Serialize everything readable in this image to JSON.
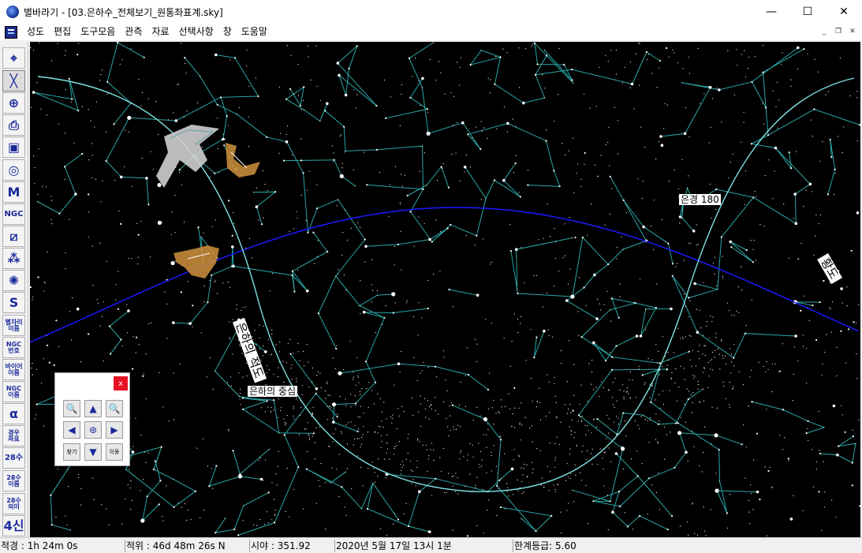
{
  "window": {
    "title": "별바라기 - [03.은하수_전체보기_원통좌표계.sky]",
    "buttons": [
      "—",
      "☐",
      "✕"
    ]
  },
  "menu": {
    "items": [
      "성도",
      "편집",
      "도구모음",
      "관측",
      "자료",
      "선택사항",
      "창",
      "도움말"
    ],
    "mdi_buttons": [
      "_",
      "❐",
      "✕"
    ]
  },
  "toolbar": {
    "tools": [
      {
        "name": "cursor-tool",
        "label": "⌖",
        "icon": "crosshair-icon"
      },
      {
        "name": "constellation-lines-tool",
        "label": "╳",
        "icon": "constellation-icon",
        "active": true
      },
      {
        "name": "grid-tool",
        "label": "⊕",
        "icon": "globe-grid-icon"
      },
      {
        "name": "printer-tool",
        "label": "⎙",
        "icon": "printer-icon"
      },
      {
        "name": "sky-view-tool",
        "label": "▣",
        "icon": "sky-view-icon"
      },
      {
        "name": "galaxy-tool",
        "label": "◎",
        "icon": "galaxy-icon"
      },
      {
        "name": "messier-tool",
        "label": "M",
        "icon": "messier-icon"
      },
      {
        "name": "ngc-tool",
        "label": "NGC",
        "icon": "ngc-icon"
      },
      {
        "name": "milky-way-tool",
        "label": "⧄",
        "icon": "milky-way-icon"
      },
      {
        "name": "nebula-tool",
        "label": "⁂",
        "icon": "nebula-icon"
      },
      {
        "name": "deep-sky-tool",
        "label": "✺",
        "icon": "deep-sky-icon"
      },
      {
        "name": "ecliptic-tool",
        "label": "S",
        "icon": "ecliptic-icon"
      },
      {
        "name": "star-names-tool",
        "label": "별자리\n이름",
        "icon": "star-names-icon"
      },
      {
        "name": "ngc-numbers-tool",
        "label": "NGC\n번호",
        "icon": "ngc-numbers-icon"
      },
      {
        "name": "bayer-names-tool",
        "label": "바이어\n이름",
        "icon": "bayer-names-icon"
      },
      {
        "name": "ngc-names-tool",
        "label": "NGC\n이름",
        "icon": "ngc-names-icon"
      },
      {
        "name": "alpha-tool",
        "label": "α",
        "icon": "alpha-icon"
      },
      {
        "name": "coordinates-tool",
        "label": "경우\n좌표",
        "icon": "coordinates-icon"
      },
      {
        "name": "28-mansions-tool",
        "label": "28수",
        "icon": "mansions-icon"
      },
      {
        "name": "28-names-tool",
        "label": "28수\n이름",
        "icon": "mansions-names-icon"
      },
      {
        "name": "28-meanings-tool",
        "label": "28수\n의미",
        "icon": "mansions-meanings-icon"
      },
      {
        "name": "four-beasts-tool",
        "label": "4신",
        "icon": "four-beasts-icon"
      }
    ]
  },
  "sky": {
    "labels": {
      "galactic_longitude": "은경 180",
      "ecliptic": "황도",
      "galactic_equator": "은하의 적도",
      "galactic_center": "은하의 중심"
    },
    "colors": {
      "background": "#000000",
      "constellation_lines": "#2aa6a6",
      "ecliptic": "#1a1aff",
      "galactic_equator": "#7fe3e3",
      "stars": "#ffffff"
    }
  },
  "navigator": {
    "close": "x",
    "buttons": [
      {
        "name": "zoom-out-button",
        "label": "🔍",
        "icon": "zoom-out-icon"
      },
      {
        "name": "pan-up-button",
        "label": "▲",
        "icon": "arrow-up-icon"
      },
      {
        "name": "zoom-in-button",
        "label": "🔍",
        "icon": "zoom-in-icon"
      },
      {
        "name": "pan-left-button",
        "label": "◀",
        "icon": "arrow-left-icon"
      },
      {
        "name": "center-button",
        "label": "⊛",
        "icon": "target-icon"
      },
      {
        "name": "pan-right-button",
        "label": "▶",
        "icon": "arrow-right-icon"
      },
      {
        "name": "find-button",
        "label": "찾기",
        "icon": "find-icon"
      },
      {
        "name": "pan-down-button",
        "label": "▼",
        "icon": "arrow-down-icon"
      },
      {
        "name": "move-button",
        "label": "이동",
        "icon": "move-icon"
      }
    ]
  },
  "status": {
    "ra": "적경 :   1h 24m   0s",
    "dec": "적위 : 46d 48m 26s N",
    "fov": "시야 : 351.92",
    "datetime": "2020년  5월 17일 13시  1분",
    "limit_mag": "한계등급:  5.60"
  }
}
